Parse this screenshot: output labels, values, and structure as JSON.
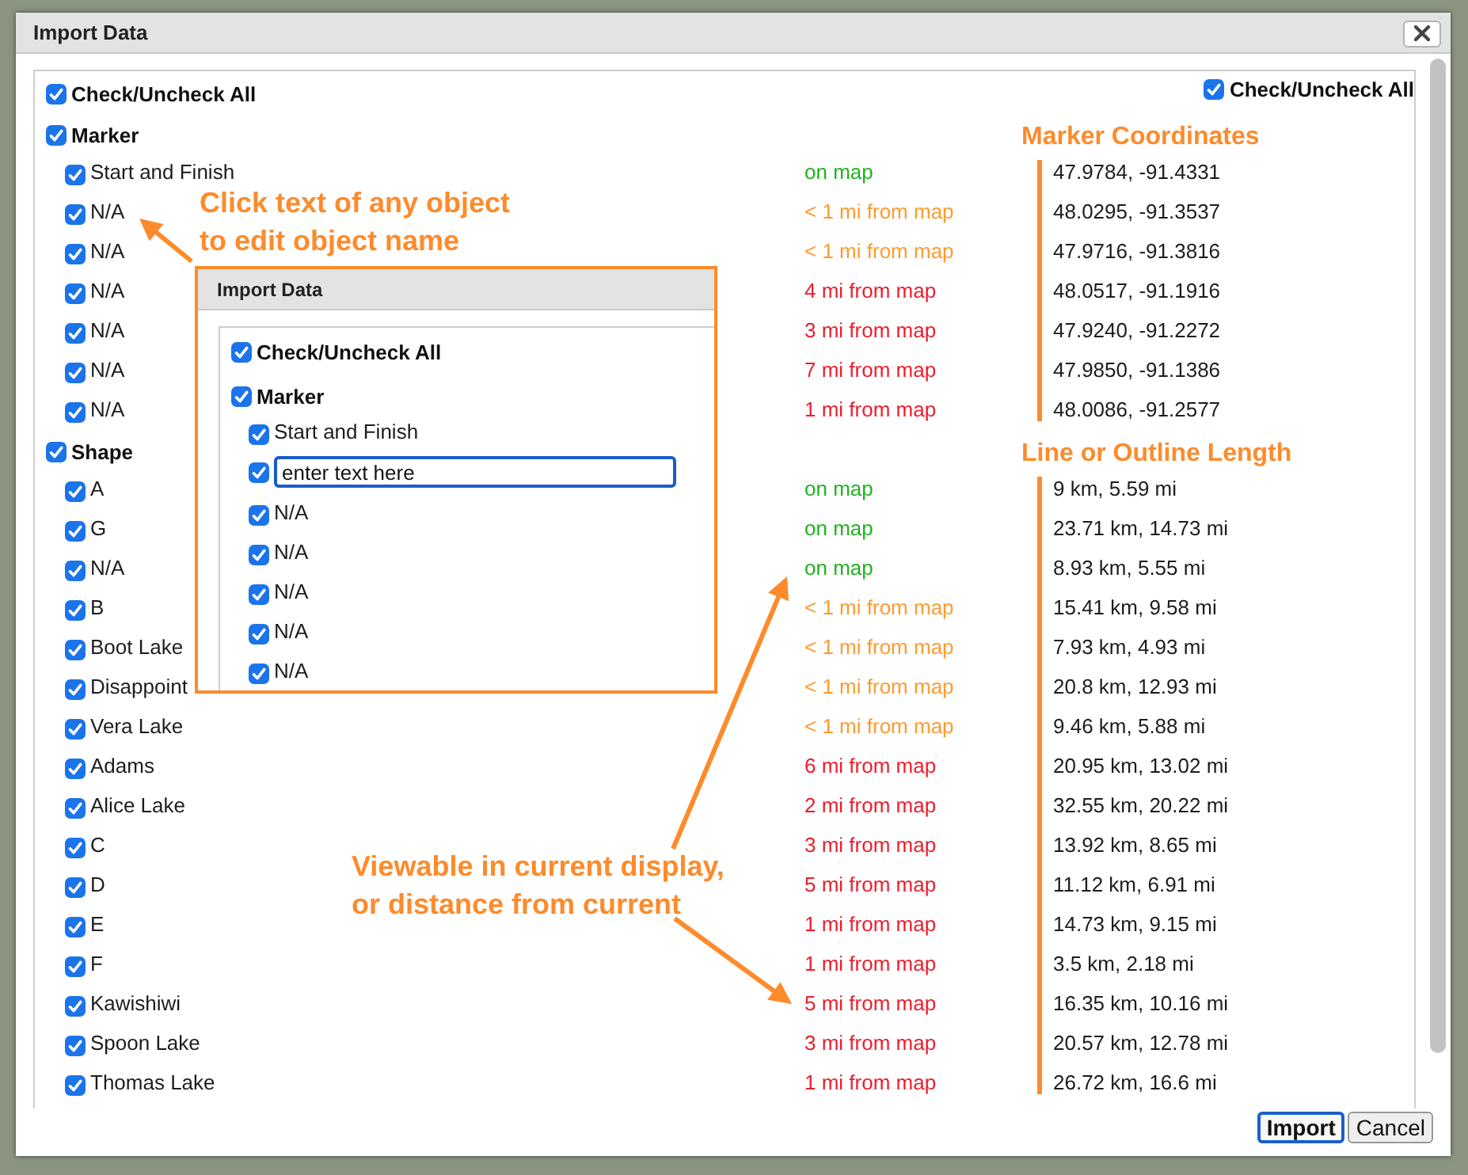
{
  "window": {
    "title": "Import Data"
  },
  "check_all": {
    "label": "Check/Uncheck All",
    "checked": true
  },
  "check_all_right": {
    "label": "Check/Uncheck All",
    "checked": true
  },
  "groups": [
    {
      "label": "Marker",
      "checked": true,
      "column_heading": "Marker Coordinates",
      "items": [
        {
          "name": "Start and Finish",
          "checked": true,
          "status": "on map",
          "color": "#1fb31f",
          "value": "47.9784, -91.4331"
        },
        {
          "name": "N/A",
          "checked": true,
          "status": "< 1 mi from map",
          "color": "#ff9a2e",
          "value": "48.0295, -91.3537"
        },
        {
          "name": "N/A",
          "checked": true,
          "status": "< 1 mi from map",
          "color": "#ff9a2e",
          "value": "47.9716, -91.3816"
        },
        {
          "name": "N/A",
          "checked": true,
          "status": "4 mi from map",
          "color": "#ee1c2b",
          "value": "48.0517, -91.1916"
        },
        {
          "name": "N/A",
          "checked": true,
          "status": "3 mi from map",
          "color": "#ee1c2b",
          "value": "47.9240, -91.2272"
        },
        {
          "name": "N/A",
          "checked": true,
          "status": "7 mi from map",
          "color": "#ee1c2b",
          "value": "47.9850, -91.1386"
        },
        {
          "name": "N/A",
          "checked": true,
          "status": "1 mi from map",
          "color": "#ee1c2b",
          "value": "48.0086, -91.2577"
        }
      ]
    },
    {
      "label": "Shape",
      "checked": true,
      "column_heading": "Line or Outline Length",
      "items": [
        {
          "name": "A",
          "checked": true,
          "status": "on map",
          "color": "#1fb31f",
          "value": "9 km, 5.59 mi"
        },
        {
          "name": "G",
          "checked": true,
          "status": "on map",
          "color": "#1fb31f",
          "value": "23.71 km, 14.73 mi"
        },
        {
          "name": "N/A",
          "checked": true,
          "status": "on map",
          "color": "#1fb31f",
          "value": "8.93 km, 5.55 mi"
        },
        {
          "name": "B",
          "checked": true,
          "status": "< 1 mi from map",
          "color": "#ff9a2e",
          "value": "15.41 km, 9.58 mi"
        },
        {
          "name": "Boot Lake",
          "checked": true,
          "status": "< 1 mi from map",
          "color": "#ff9a2e",
          "value": "7.93 km, 4.93 mi"
        },
        {
          "name": "Disappoint",
          "checked": true,
          "status": "< 1 mi from map",
          "color": "#ff9a2e",
          "value": "20.8 km, 12.93 mi"
        },
        {
          "name": "Vera Lake",
          "checked": true,
          "status": "< 1 mi from map",
          "color": "#ff9a2e",
          "value": "9.46 km, 5.88 mi"
        },
        {
          "name": "Adams",
          "checked": true,
          "status": "6 mi from map",
          "color": "#ee1c2b",
          "value": "20.95 km, 13.02 mi"
        },
        {
          "name": "Alice Lake",
          "checked": true,
          "status": "2 mi from map",
          "color": "#ee1c2b",
          "value": "32.55 km, 20.22 mi"
        },
        {
          "name": "C",
          "checked": true,
          "status": "3 mi from map",
          "color": "#ee1c2b",
          "value": "13.92 km, 8.65 mi"
        },
        {
          "name": "D",
          "checked": true,
          "status": "5 mi from map",
          "color": "#ee1c2b",
          "value": "11.12 km, 6.91 mi"
        },
        {
          "name": "E",
          "checked": true,
          "status": "1 mi from map",
          "color": "#ee1c2b",
          "value": "14.73 km, 9.15 mi"
        },
        {
          "name": "F",
          "checked": true,
          "status": "1 mi from map",
          "color": "#ee1c2b",
          "value": "3.5 km, 2.18 mi"
        },
        {
          "name": "Kawishiwi",
          "checked": true,
          "status": "5 mi from map",
          "color": "#ee1c2b",
          "value": "16.35 km, 10.16 mi"
        },
        {
          "name": "Spoon Lake",
          "checked": true,
          "status": "3 mi from map",
          "color": "#ee1c2b",
          "value": "20.57 km, 12.78 mi"
        },
        {
          "name": "Thomas Lake",
          "checked": true,
          "status": "1 mi from map",
          "color": "#ee1c2b",
          "value": "26.72 km, 16.6 mi"
        }
      ]
    }
  ],
  "callouts": [
    {
      "text": "Click text of any object\nto edit object name"
    },
    {
      "text": "Viewable in current display,\nor distance from current"
    }
  ],
  "inset": {
    "title": "Import Data",
    "check_all": {
      "label": "Check/Uncheck All",
      "checked": true
    },
    "group": {
      "label": "Marker",
      "checked": true
    },
    "items": [
      {
        "kind": "label",
        "name": "Start and Finish",
        "checked": true
      },
      {
        "kind": "input",
        "value": "enter text here",
        "checked": true
      },
      {
        "kind": "label",
        "name": "N/A",
        "checked": true
      },
      {
        "kind": "label",
        "name": "N/A",
        "checked": true
      },
      {
        "kind": "label",
        "name": "N/A",
        "checked": true
      },
      {
        "kind": "label",
        "name": "N/A",
        "checked": true
      },
      {
        "kind": "label",
        "name": "N/A",
        "checked": true
      }
    ]
  },
  "buttons": [
    {
      "label": "Import",
      "default": true
    },
    {
      "label": "Cancel",
      "default": false
    }
  ]
}
